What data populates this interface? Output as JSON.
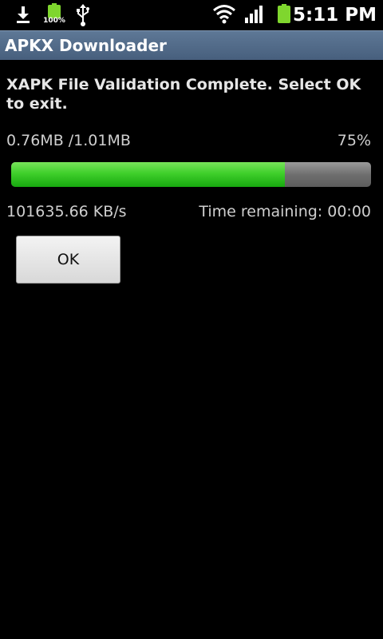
{
  "status_bar": {
    "battery_small_percent": "100%",
    "time": "5:11 PM",
    "icons": [
      "download-icon",
      "battery-icon",
      "usb-icon",
      "wifi-icon",
      "signal-icon",
      "battery-icon"
    ],
    "battery_color": "#7fd62e"
  },
  "title_bar": {
    "title": "APKX Downloader",
    "color": "#52698a"
  },
  "main": {
    "message": "XAPK File Validation Complete.  Select OK to exit.",
    "progress_text": "0.76MB /1.01MB",
    "progress_percent_label": "75%",
    "progress_fraction": 0.76,
    "progress_color": "#3fcf2b",
    "speed": "101635.66 KB/s",
    "time_remaining": "Time remaining: 00:00",
    "ok_label": "OK"
  }
}
